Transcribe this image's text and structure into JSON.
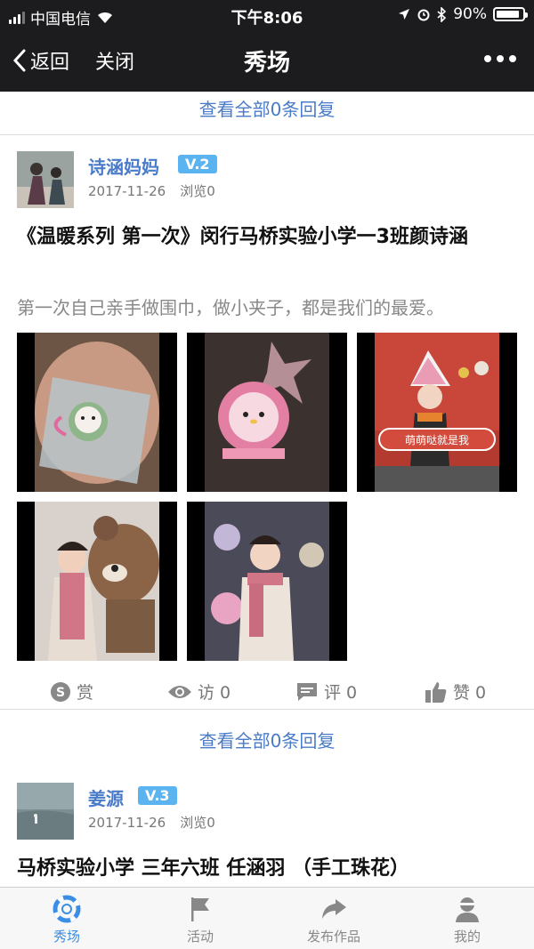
{
  "status_bar": {
    "carrier": "中国电信",
    "time": "下午8:06",
    "battery": "90%",
    "battery_level": 0.9
  },
  "nav": {
    "back_label": "返回",
    "close_label": "关闭",
    "title": "秀场"
  },
  "view_all_replies": "查看全部0条回复",
  "posts": [
    {
      "author": "诗涵妈妈",
      "level": "V.2",
      "date": "2017-11-26",
      "views": "浏览0",
      "title": "《温暖系列 第一次》闵行马桥实验小学一3班颜诗涵",
      "description": "第一次自己亲手做围巾，做小夹子，都是我们的最爱。",
      "photo_count": 5,
      "actions": {
        "reward": "赏",
        "visits": "访 0",
        "comments": "评 0",
        "likes": "赞 0"
      }
    },
    {
      "author": "姜源",
      "level": "V.3",
      "date": "2017-11-26",
      "views": "浏览0",
      "title": "马桥实验小学 三年六班 任涵羽 （手工珠花）"
    }
  ],
  "photo_sign_text": "萌萌哒就是我",
  "tabs": [
    {
      "label": "秀场",
      "icon": "lifebuoy-icon",
      "active": true
    },
    {
      "label": "活动",
      "icon": "flag-icon",
      "active": false
    },
    {
      "label": "发布作品",
      "icon": "share-arrow-icon",
      "active": false
    },
    {
      "label": "我的",
      "icon": "user-icon",
      "active": false
    }
  ],
  "colors": {
    "link": "#4a7bc8",
    "badge": "#5bb4f0",
    "active_tab": "#3a8ee6",
    "header_bg": "#1c1c1e"
  }
}
